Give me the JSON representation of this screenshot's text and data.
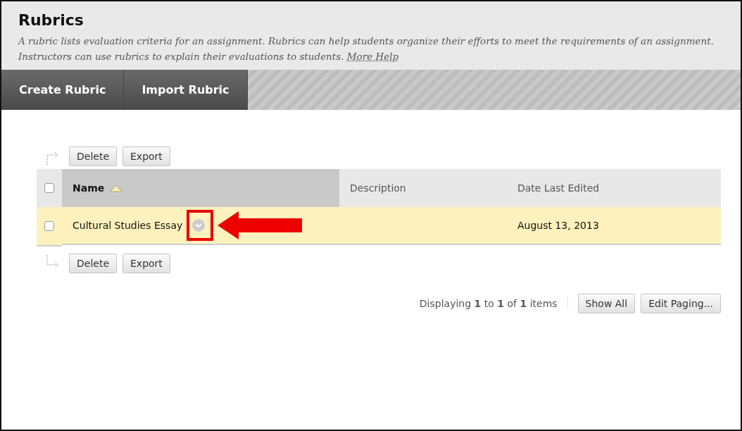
{
  "header": {
    "title": "Rubrics",
    "description": "A rubric lists evaluation criteria for an assignment. Rubrics can help students organize their efforts to meet the requirements of an assignment. Instructors can use rubrics to explain their evaluations to students.",
    "help_link": "More Help"
  },
  "action_bar": [
    "Create Rubric",
    "Import Rubric"
  ],
  "top_actions": [
    "Delete",
    "Export"
  ],
  "table": {
    "select_all": {
      "checked": false
    },
    "columns": [
      {
        "label": "Name",
        "sorted": true
      },
      {
        "label": "Description",
        "sorted": false
      },
      {
        "label": "Date Last Edited",
        "sorted": false
      }
    ],
    "rows": [
      {
        "checked": false,
        "highlighted": true,
        "name": "Cultural Studies Essay",
        "description": "",
        "date": "August 13, 2013"
      }
    ]
  },
  "bottom_actions": [
    "Delete",
    "Export"
  ],
  "paging": {
    "summary": "Displaying **1** to **1** of **1** items",
    "buttons": [
      "Show All",
      "Edit Paging..."
    ]
  }
}
